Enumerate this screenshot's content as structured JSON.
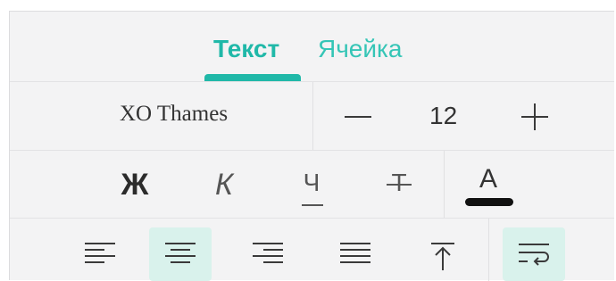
{
  "tabs": {
    "text": "Текст",
    "cell": "Ячейка",
    "active": "text"
  },
  "font": {
    "name": "XO Thames",
    "size": "12"
  },
  "formatting": {
    "bold_label": "Ж",
    "italic_label": "К",
    "underline_label": "Ч",
    "strikethrough_label": "Т",
    "color_label": "A",
    "current_color": "#111111"
  },
  "alignment": {
    "active": "center",
    "wrap_active": true,
    "icons": [
      "align-left-icon",
      "align-center-icon",
      "align-right-icon",
      "align-justify-icon",
      "align-top-icon",
      "text-wrap-icon"
    ]
  },
  "colors": {
    "accent": "#20b8a8",
    "active_bg": "#d9f2ec"
  }
}
